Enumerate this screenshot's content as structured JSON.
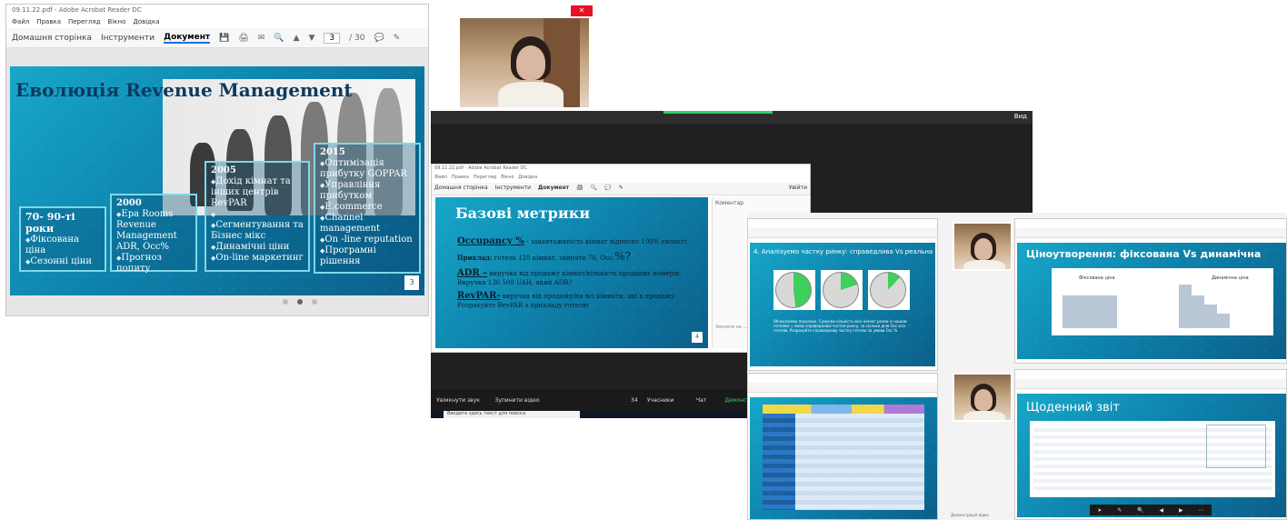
{
  "left_window": {
    "title": "09.11.22.pdf - Adobe Acrobat Reader DC",
    "menu": [
      "Файл",
      "Правка",
      "Перегляд",
      "Вікно",
      "Довідка"
    ],
    "tabs": [
      "Домашня сторінка",
      "Інструменти",
      "Документ"
    ],
    "page_num": "3",
    "page_total": "/ 30",
    "slide": {
      "title": "Еволюція Revenue Management",
      "badge": "3",
      "b1": {
        "hdr": "70- 90-ті роки",
        "items": [
          "Фіксована ціна",
          "Сезонні ціни"
        ]
      },
      "b2": {
        "hdr": "2000",
        "items": [
          "Ера Rooms Revenue Management ADR, Occ%",
          "Прогноз попиту"
        ]
      },
      "b3": {
        "hdr": "2005",
        "items": [
          "Дохід кімнат та інших центрів RevPAR",
          "",
          "Сегментування та Бізнес мікс",
          "Динамічні ціни",
          "On-line маркетинг"
        ]
      },
      "b4": {
        "hdr": "2015",
        "items": [
          "Оптимізація прибутку GOPPAR",
          "Управління прибутком",
          "E.commerce",
          "Channel management",
          "On -line reputation",
          "Програмні рішення"
        ]
      }
    }
  },
  "center_window": {
    "header_right": "Вид",
    "acrobat_title": "09.11.22.pdf - Adobe Acrobat Reader DC",
    "menu": [
      "Файл",
      "Правка",
      "Перегляд",
      "Вікно",
      "Довідка"
    ],
    "tabs": [
      "Домашня сторінка",
      "Інструменти",
      "Документ"
    ],
    "side_label": "Коментар",
    "side_text": "Змінити на ...",
    "toolbar_right": "Увійти",
    "slide": {
      "title": "Базові метрики",
      "l1a": "Occupancy %",
      "l1b": " - завантажкність кімнат відносно 100% ємності",
      "l2a": "Приклад:",
      "l2b": " готель 120 кімнат, зайнято 70, Occ.",
      "l2c": "%?",
      "l3a": "ADR –",
      "l3b": " виручка від продажу кімнат/кількість проданих номерів. Виручка 136 500 UAH, який ADR?",
      "l4a": "RevPAR-",
      "l4b": " виручка від продажу/на всі кімнати, які в продажу. Розрахуйте RevPAR з прикладу готелю",
      "badge": "4"
    },
    "zoom": [
      "Увімкнути звук",
      "Зупинити відео",
      "Учасники",
      "Чат",
      "Демонстрація екрана"
    ],
    "participants_count": "34",
    "taskbar_search": "Введите здесь текст для поиска"
  },
  "right_grid": {
    "tl_title": "4. Аналізуємо частку ринку: справедлива Vs реальна",
    "tl_body": "Обчислюємо показник. Сумуємо кількість всіх кімнат разом із нашим готелем = якою справедливої частки ринку, за скільки днів Occ всіх готелів. Розрахуйте справедливу частку готелю за умови Occ %",
    "tr_title": "Ціноутворення: фіксована Vs динамічна",
    "tr_label1": "Фіксована ціна",
    "tr_label2": "Динамічна ціна",
    "bl_title": "",
    "br_title": "Щоденний звіт",
    "caption": "Демонстрація відео"
  }
}
